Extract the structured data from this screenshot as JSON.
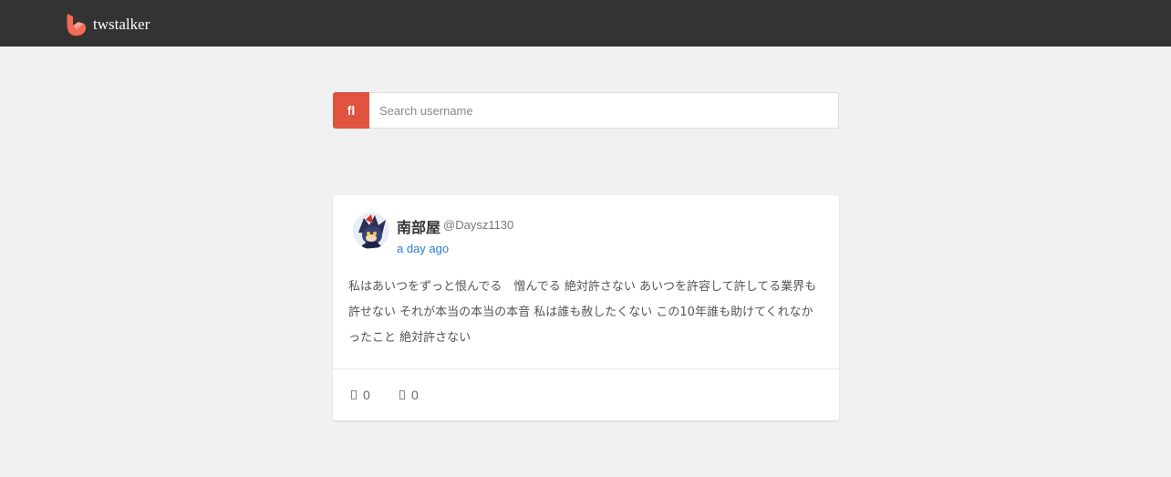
{
  "header": {
    "brand_name": "twstalker",
    "logo_icon": "twstalker-logo-icon",
    "background_color": "#333333",
    "logo_color": "#f26b55"
  },
  "search": {
    "button_label": "fl",
    "placeholder": "Search username",
    "value": "",
    "button_color": "#e0533f"
  },
  "tweet": {
    "display_name": "南部屋",
    "handle": "@Daysz1130",
    "time": "a day ago",
    "text": "私はあいつをずっと恨んでる　憎んでる 絶対許さない あいつを許容して許してる業界も許せない それが本当の本当の本音 私は誰も赦したくない この10年誰も助けてくれなかったこと 絶対許さない",
    "retweet_count": "0",
    "like_count": "0",
    "retweet_icon": "retweet-icon",
    "like_icon": "like-icon",
    "link_color": "#2a7fd4"
  }
}
